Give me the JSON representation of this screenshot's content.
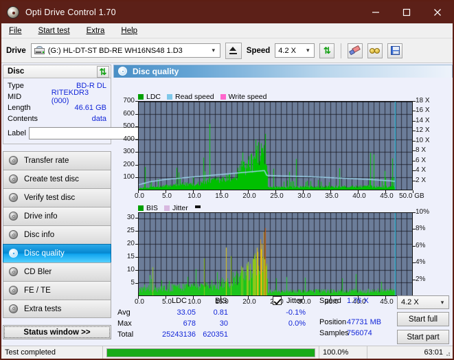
{
  "window": {
    "title": "Opti Drive Control 1.70",
    "icon": "disc-icon",
    "minimize": "minimize-icon",
    "maximize": "maximize-icon",
    "close": "close-icon"
  },
  "menu": [
    {
      "label": "File"
    },
    {
      "label": "Start test"
    },
    {
      "label": "Extra"
    },
    {
      "label": "Help"
    }
  ],
  "toolbar": {
    "drive_label": "Drive",
    "drive_value": "(G:)  HL-DT-ST BD-RE  WH16NS48 1.D3",
    "eject_icon": "eject-icon",
    "speed_label": "Speed",
    "speed_value": "4.2 X",
    "refresh_icon": "refresh-icon",
    "erase_icon": "eraser-icon",
    "goggles_icon": "goggles-icon",
    "save_icon": "save-icon"
  },
  "disc_panel": {
    "title": "Disc",
    "refresh_icon": "refresh-icon",
    "rows": [
      {
        "key": "Type",
        "value": "BD-R DL"
      },
      {
        "key": "MID",
        "value": "RITEKDR3 (000)"
      },
      {
        "key": "Length",
        "value": "46.61 GB"
      },
      {
        "key": "Contents",
        "value": "data"
      }
    ],
    "label_key": "Label",
    "label_value": "",
    "label_button_icon": "cd-icon"
  },
  "sidebar": {
    "items": [
      {
        "label": "Transfer rate",
        "active": false
      },
      {
        "label": "Create test disc",
        "active": false
      },
      {
        "label": "Verify test disc",
        "active": false
      },
      {
        "label": "Drive info",
        "active": false
      },
      {
        "label": "Disc info",
        "active": false
      },
      {
        "label": "Disc quality",
        "active": true
      },
      {
        "label": "CD Bler",
        "active": false
      },
      {
        "label": "FE / TE",
        "active": false
      },
      {
        "label": "Extra tests",
        "active": false
      }
    ],
    "status_button": "Status window >>"
  },
  "main": {
    "header": "Disc quality",
    "header_icon": "disc-quality-icon"
  },
  "stats": {
    "col_ldc": "LDC",
    "col_bis": "BIS",
    "jitter_label": "Jitter",
    "jitter_checked": true,
    "rows": [
      {
        "name": "Avg",
        "ldc": "33.05",
        "bis": "0.81",
        "jitter": "-0.1%"
      },
      {
        "name": "Max",
        "ldc": "678",
        "bis": "30",
        "jitter": "0.0%"
      },
      {
        "name": "Total",
        "ldc": "25243136",
        "bis": "620351",
        "jitter": ""
      }
    ],
    "speed_label": "Speed",
    "speed_value": "1.76 X",
    "position_label": "Position",
    "position_value": "47731 MB",
    "samples_label": "Samples",
    "samples_value": "756074",
    "speed_select": "4.2 X",
    "start_full": "Start full",
    "start_part": "Start part"
  },
  "statusbar": {
    "message": "Test completed",
    "progress_percent": 100.0,
    "progress_text": "100.0%",
    "elapsed": "63:01"
  },
  "chart_data": [
    {
      "id": "ldc-chart",
      "type": "area",
      "title": "Disc quality",
      "xlabel": "GB",
      "ylabel": "LDC",
      "legend": [
        {
          "label": "LDC",
          "color": "#00a000"
        },
        {
          "label": "Read speed",
          "color": "#7ec8ea"
        },
        {
          "label": "Write speed",
          "color": "#ff66cc"
        }
      ],
      "legend_position": "top-left",
      "grid": true,
      "xlim": [
        0.0,
        50.0
      ],
      "xticks": [
        "0.0",
        "5.0",
        "10.0",
        "15.0",
        "20.0",
        "25.0",
        "30.0",
        "35.0",
        "40.0",
        "45.0",
        "50.0 GB"
      ],
      "ylim": [
        0,
        700
      ],
      "yticks": [
        100,
        200,
        300,
        400,
        500,
        600,
        700
      ],
      "y2label": "X",
      "y2lim": [
        0,
        18
      ],
      "y2ticks": [
        "2 X",
        "4 X",
        "6 X",
        "8 X",
        "10 X",
        "12 X",
        "14 X",
        "16 X",
        "18 X"
      ],
      "data_end_gb": 46.9,
      "series": [
        {
          "name": "LDC",
          "color": "#00c000",
          "kind": "vertical-bars",
          "baseline_x": [
            0.0,
            3.0,
            7.0,
            11.0,
            15.0,
            18.0,
            20.5,
            22.0,
            23.2,
            23.6,
            30.0,
            38.0,
            46.9
          ],
          "baseline_y": [
            10,
            22,
            38,
            55,
            78,
            110,
            160,
            215,
            250,
            18,
            22,
            24,
            26
          ],
          "spike_max": 678,
          "peak_region_gb": [
            18.0,
            23.5
          ]
        },
        {
          "name": "Read speed",
          "color": "#9fd8f0",
          "kind": "line",
          "x": [
            0.0,
            2.0,
            5.0,
            8.0,
            11.0,
            14.0,
            17.0,
            20.0,
            23.0,
            23.4,
            26.0,
            30.0,
            34.0,
            38.0,
            42.0,
            46.0,
            46.9
          ],
          "y_x_units": [
            1.0,
            1.6,
            2.1,
            2.4,
            2.7,
            3.0,
            3.3,
            3.6,
            3.9,
            2.9,
            2.8,
            2.7,
            2.5,
            2.3,
            2.1,
            1.8,
            1.7
          ]
        },
        {
          "name": "Write speed",
          "color": "#ff66cc",
          "kind": "line",
          "x": [],
          "y_x_units": []
        }
      ],
      "marker_line_gb": 46.9,
      "marker_color": "#3ec8e8"
    },
    {
      "id": "bis-chart",
      "type": "area",
      "xlabel": "GB",
      "ylabel": "BIS",
      "legend": [
        {
          "label": "BIS",
          "color": "#00a000"
        },
        {
          "label": "Jitter",
          "color": "#d8b8e0"
        }
      ],
      "legend_position": "top-left",
      "grid": true,
      "xlim": [
        0.0,
        50.0
      ],
      "xticks": [
        "0.0",
        "5.0",
        "10.0",
        "15.0",
        "20.0",
        "25.0",
        "30.0",
        "35.0",
        "40.0",
        "45.0",
        "50.0 GB"
      ],
      "ylim": [
        0,
        32
      ],
      "yticks": [
        5,
        10,
        15,
        20,
        25,
        30
      ],
      "y2label": "%",
      "y2lim": [
        0,
        10.6
      ],
      "y2ticks": [
        "2%",
        "4%",
        "6%",
        "8%",
        "10%"
      ],
      "data_end_gb": 46.9,
      "series": [
        {
          "name": "BIS",
          "color_low": "#00c000",
          "color_mid": "#e8c000",
          "color_high": "#e07010",
          "kind": "vertical-bars",
          "baseline_x": [
            0.0,
            4.0,
            8.0,
            12.0,
            15.0,
            18.0,
            20.0,
            21.5,
            22.6,
            23.2,
            23.6,
            30.0,
            38.0,
            46.9
          ],
          "baseline_y": [
            2.5,
            2.8,
            3.2,
            3.8,
            4.6,
            6.5,
            9.0,
            12.0,
            16.0,
            20.0,
            1.5,
            1.6,
            1.7,
            1.8
          ],
          "spike_max": 30,
          "peak_region_gb": [
            18.0,
            23.5
          ]
        }
      ],
      "marker_line_gb": 46.9,
      "marker_color": "#3ec8e8"
    }
  ]
}
